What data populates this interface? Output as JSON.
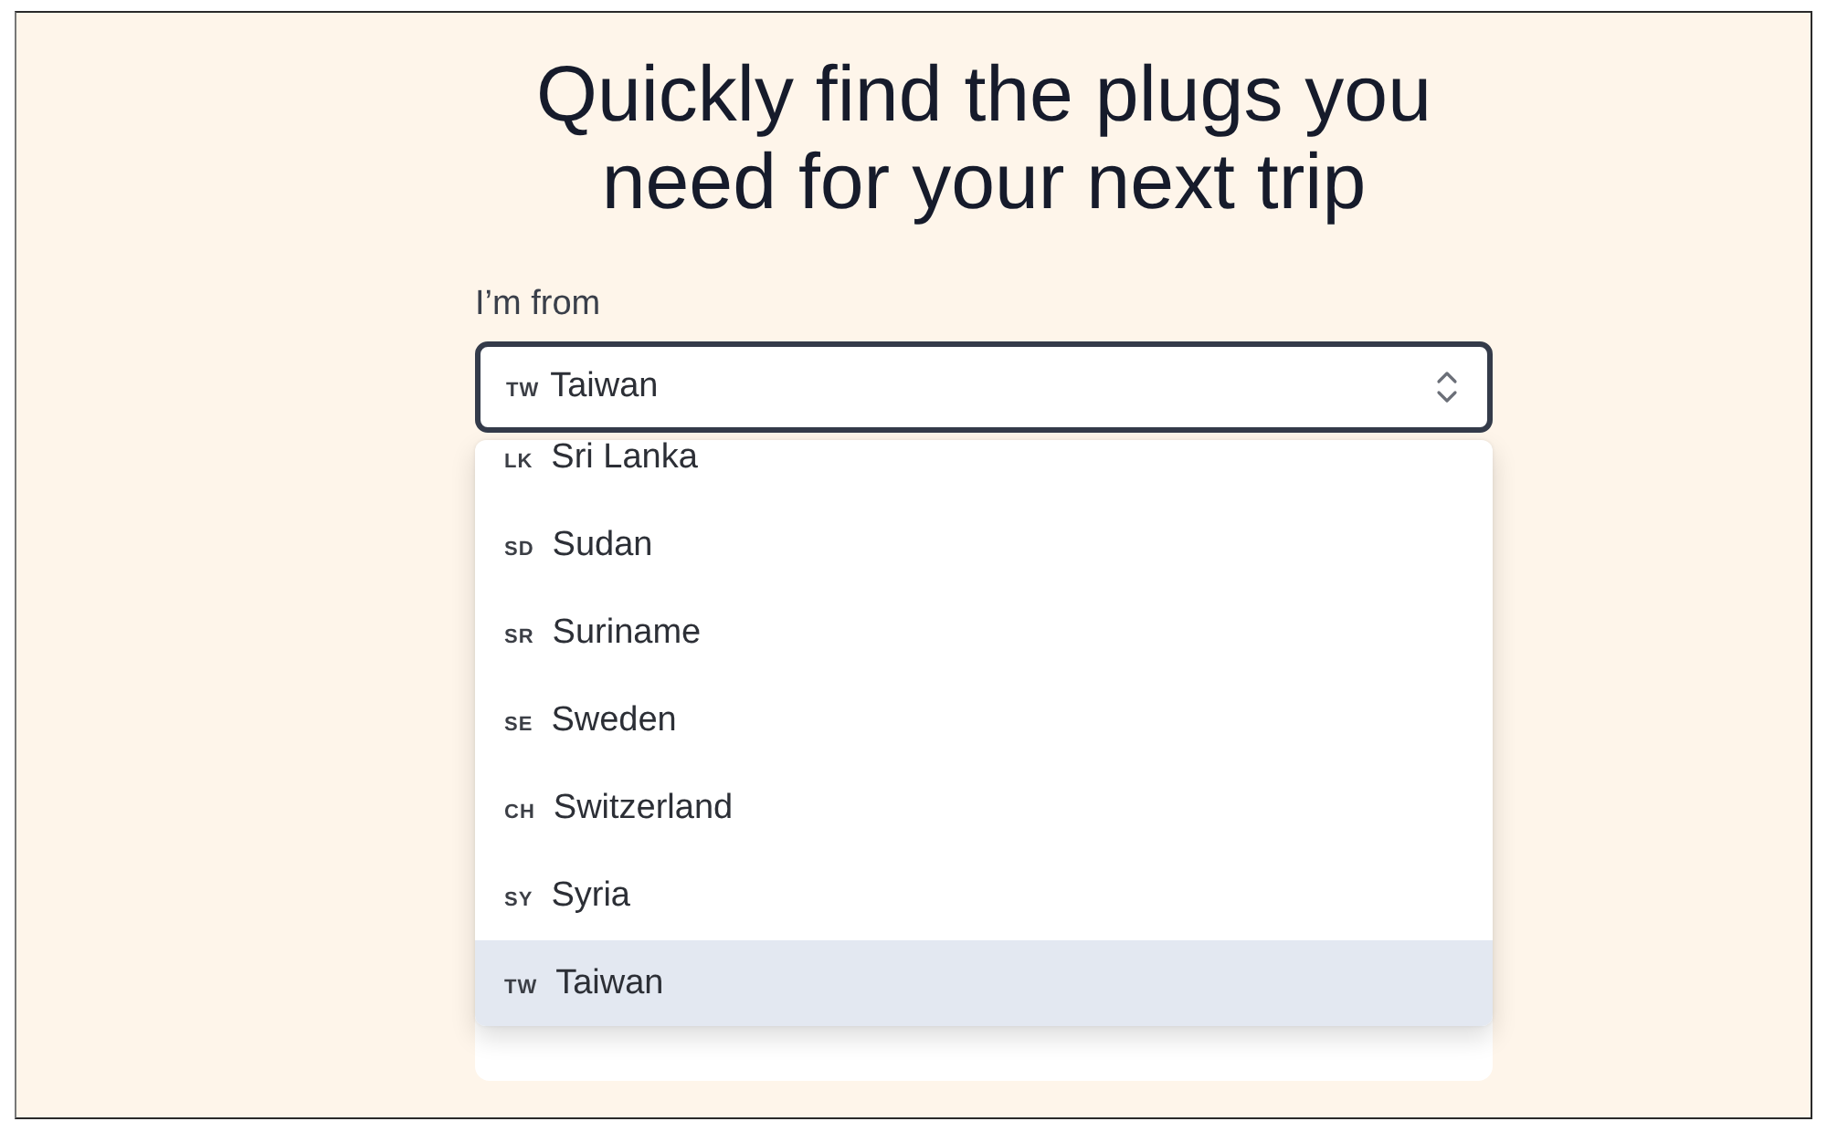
{
  "page": {
    "title": "Quickly find the plugs you need for your next trip"
  },
  "origin_select": {
    "label": "I’m from",
    "value_code": "TW",
    "value": "Taiwan",
    "expanded": true
  },
  "options": [
    {
      "code": "LK",
      "name": "Sri Lanka",
      "selected": false
    },
    {
      "code": "SD",
      "name": "Sudan",
      "selected": false
    },
    {
      "code": "SR",
      "name": "Suriname",
      "selected": false
    },
    {
      "code": "SE",
      "name": "Sweden",
      "selected": false
    },
    {
      "code": "CH",
      "name": "Switzerland",
      "selected": false
    },
    {
      "code": "SY",
      "name": "Syria",
      "selected": false
    },
    {
      "code": "TW",
      "name": "Taiwan",
      "selected": true
    }
  ]
}
